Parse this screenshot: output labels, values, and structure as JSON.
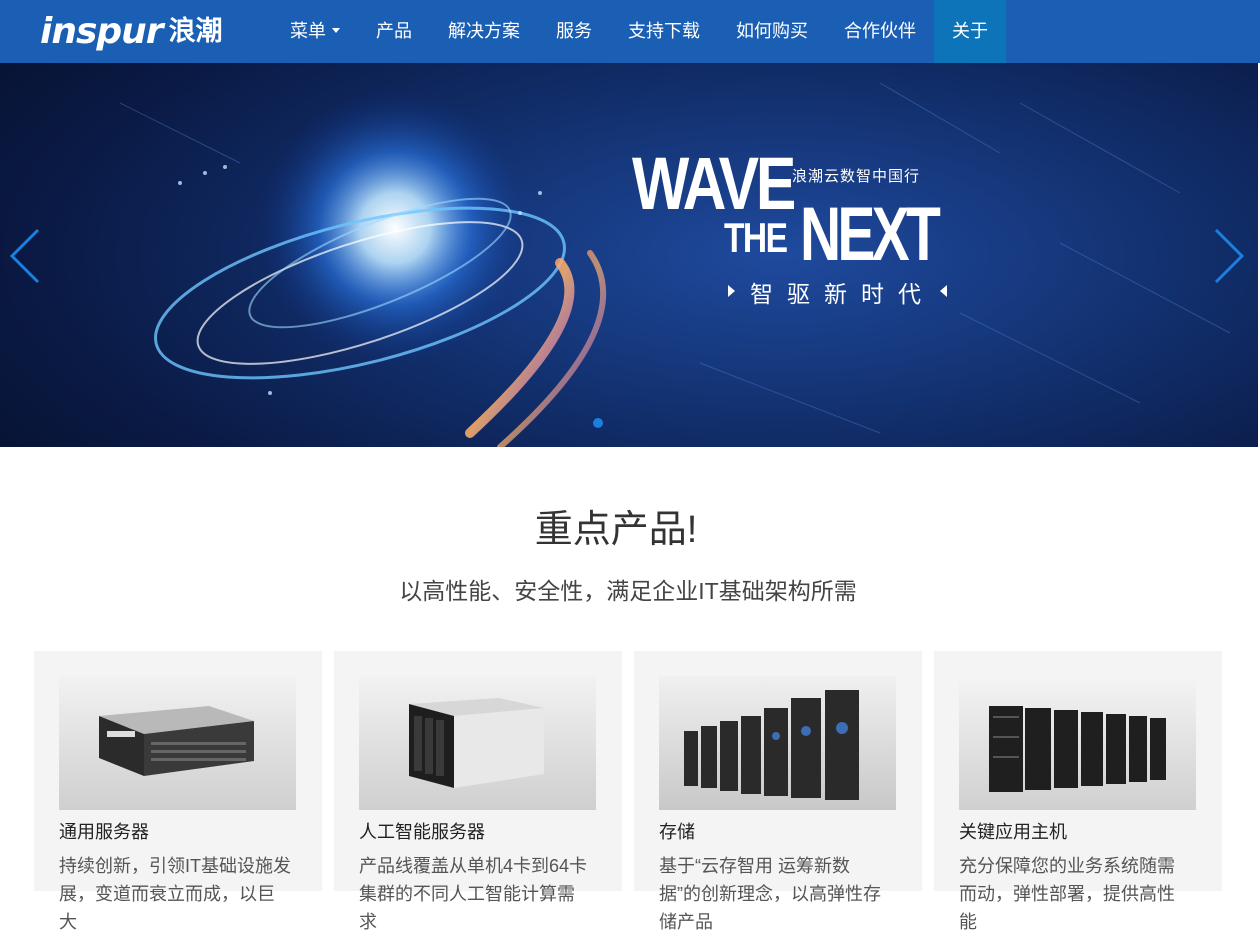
{
  "nav": {
    "logo_en": "inspur",
    "logo_cn": "浪潮",
    "items": [
      {
        "label": "菜单"
      },
      {
        "label": "产品"
      },
      {
        "label": "解决方案"
      },
      {
        "label": "服务"
      },
      {
        "label": "支持下载"
      },
      {
        "label": "如何购买"
      },
      {
        "label": "合作伙伴"
      },
      {
        "label": "关于"
      }
    ],
    "active_item": "关于"
  },
  "banner": {
    "wave": "WAVE",
    "tagline": "浪潮云数智中国行",
    "the": "THE",
    "next": "NEXT",
    "slogan": "智驱新时代"
  },
  "section": {
    "title": "重点产品!",
    "subtitle": "以高性能、安全性，满足企业IT基础架构所需"
  },
  "products": [
    {
      "name": "通用服务器",
      "desc": "持续创新，引领IT基础设施发展，变道而衰立而成，以巨大"
    },
    {
      "name": "人工智能服务器",
      "desc": "产品线覆盖从单机4卡到64卡集群的不同人工智能计算需求"
    },
    {
      "name": "存储",
      "desc": "基于“云存智用 运筹新数据”的创新理念，以高弹性存储产品"
    },
    {
      "name": "关键应用主机",
      "desc": "充分保障您的业务系统随需而动，弹性部署，提供高性能"
    }
  ],
  "colors": {
    "nav_bg": "#1a5fb4",
    "nav_active": "#0d74b9",
    "card_bg": "#f4f4f4",
    "arrow": "#1a7fe0"
  }
}
